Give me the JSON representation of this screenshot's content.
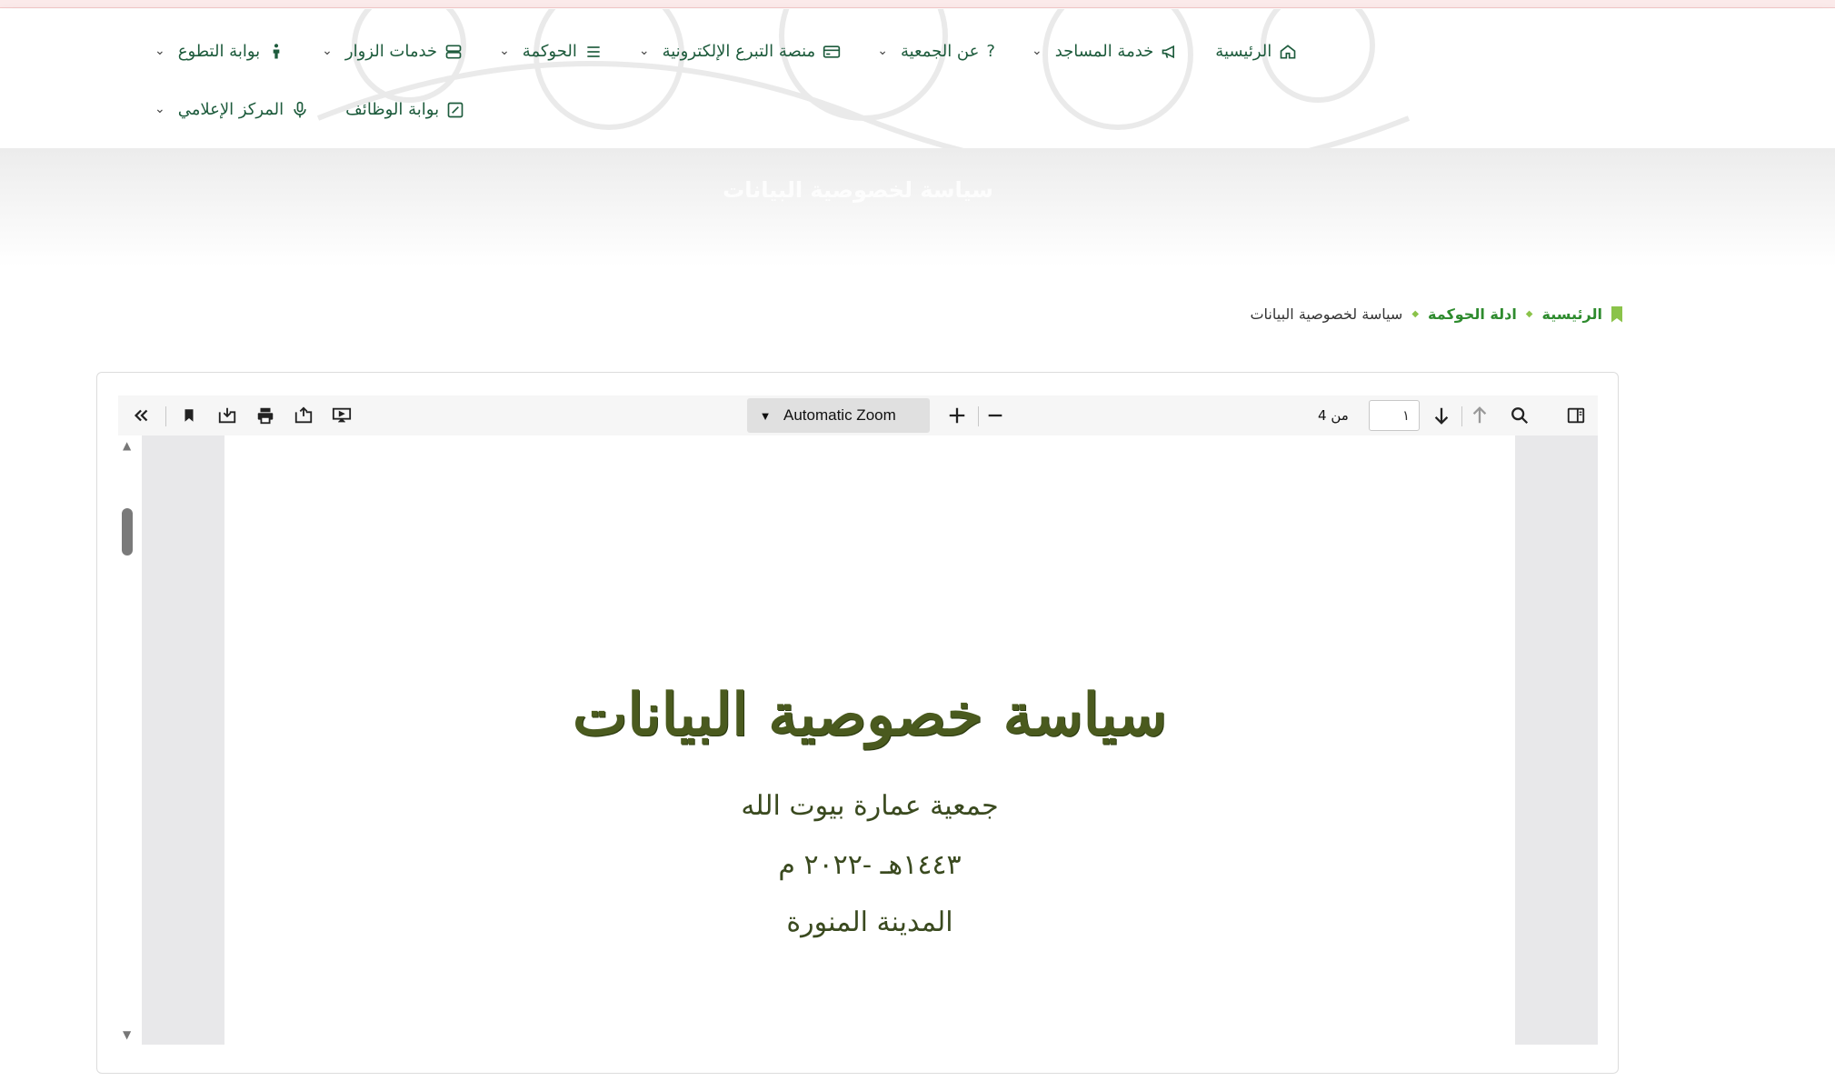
{
  "nav": {
    "row1": [
      {
        "label": "الرئيسية",
        "icon": "home-icon",
        "has_dropdown": false
      },
      {
        "label": "خدمة المساجد",
        "icon": "megaphone-icon",
        "has_dropdown": true
      },
      {
        "label": "عن الجمعية",
        "icon": "question-icon",
        "has_dropdown": true
      },
      {
        "label": "منصة التبرع الإلكترونية",
        "icon": "credit-card-icon",
        "has_dropdown": true
      },
      {
        "label": "الحوكمة",
        "icon": "list-icon",
        "has_dropdown": true
      },
      {
        "label": "خدمات الزوار",
        "icon": "server-icon",
        "has_dropdown": true
      },
      {
        "label": "بوابة التطوع",
        "icon": "person-icon",
        "has_dropdown": true
      }
    ],
    "row2": [
      {
        "label": "بوابة الوظائف",
        "icon": "edit-box-icon",
        "has_dropdown": false
      },
      {
        "label": "المركز الإعلامي",
        "icon": "microphone-icon",
        "has_dropdown": true
      }
    ],
    "question_glyph": "?"
  },
  "hero": {
    "title": "سياسة لخصوصية البيانات"
  },
  "breadcrumb": {
    "home": "الرئيسية",
    "parent": "ادلة الحوكمة",
    "current": "سياسة لخصوصية البيانات"
  },
  "viewer": {
    "zoom_label": "Automatic Zoom",
    "page_value": "١",
    "page_of": "من 4",
    "toolbar_icons": [
      "sidebar-toggle-icon",
      "search-icon",
      "previous-page-icon",
      "next-page-icon",
      "zoom-out-icon",
      "zoom-in-icon",
      "presentation-mode-icon",
      "open-file-icon",
      "print-icon",
      "download-icon",
      "bookmark-icon",
      "tools-icon"
    ]
  },
  "document": {
    "title": "سياسة خصوصية البيانات",
    "org": "جمعية عمارة بيوت الله",
    "date": "١٤٤٣هـ -٢٠٢٢ م",
    "city": "المدينة المنورة"
  },
  "colors": {
    "nav_text": "#1d5b3c",
    "breadcrumb_link": "#2e8b2e",
    "breadcrumb_accent": "#8bc34a",
    "doc_title": "#4a5a1e"
  }
}
